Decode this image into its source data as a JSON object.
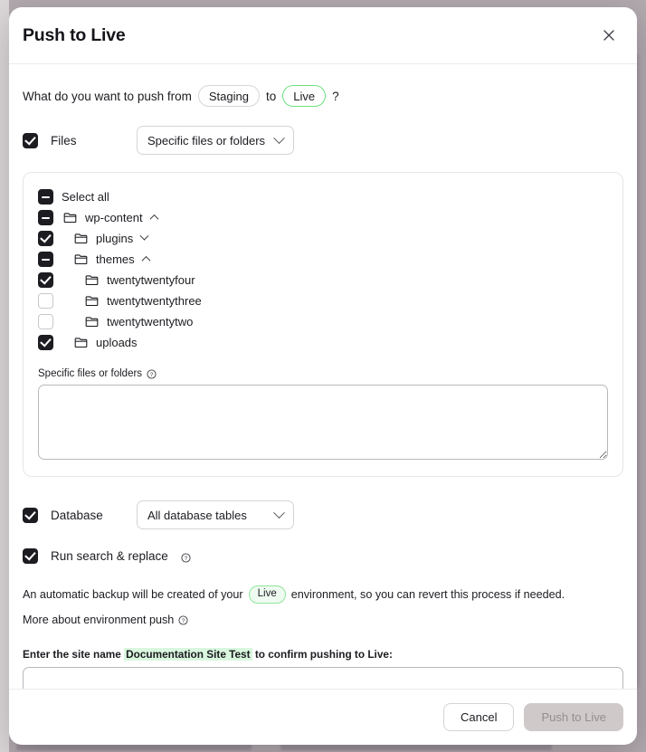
{
  "modal": {
    "title": "Push to Live",
    "close_icon": "close-icon"
  },
  "question": {
    "prefix": "What do you want to push from",
    "source_env": "Staging",
    "connector": "to",
    "target_env": "Live",
    "suffix": "?"
  },
  "files": {
    "label": "Files",
    "checked": true,
    "select_value": "Specific files or folders"
  },
  "tree": {
    "select_all_label": "Select all",
    "select_all_state": "indeterminate",
    "nodes": [
      {
        "label": "wp-content",
        "state": "indeterminate",
        "depth": 0,
        "caret": "up",
        "folder": true
      },
      {
        "label": "plugins",
        "state": "checked",
        "depth": 1,
        "caret": "down",
        "folder": true
      },
      {
        "label": "themes",
        "state": "indeterminate",
        "depth": 1,
        "caret": "up",
        "folder": true
      },
      {
        "label": "twentytwentyfour",
        "state": "checked",
        "depth": 2,
        "caret": "",
        "folder": true
      },
      {
        "label": "twentytwentythree",
        "state": "unchecked",
        "depth": 2,
        "caret": "",
        "folder": true
      },
      {
        "label": "twentytwentytwo",
        "state": "unchecked",
        "depth": 2,
        "caret": "",
        "folder": true
      },
      {
        "label": "uploads",
        "state": "checked",
        "depth": 1,
        "caret": "",
        "folder": true
      }
    ]
  },
  "specific_files": {
    "label": "Specific files or folders",
    "help_icon": "help-circle-icon",
    "value": "",
    "placeholder": ""
  },
  "database": {
    "label": "Database",
    "checked": true,
    "select_value": "All database tables"
  },
  "search_replace": {
    "label": "Run search & replace",
    "checked": true,
    "help_icon": "help-circle-icon"
  },
  "notes": {
    "backup_prefix": "An automatic backup will be created of your",
    "backup_env": "Live",
    "backup_suffix": "environment, so you can revert this process if needed.",
    "more_link": "More about environment push",
    "more_help_icon": "help-circle-icon"
  },
  "confirm": {
    "prefix": "Enter the site name",
    "site_name": "Documentation Site Test",
    "suffix": "to confirm pushing to Live:",
    "value": "",
    "placeholder": ""
  },
  "footer": {
    "cancel_label": "Cancel",
    "submit_label": "Push to Live",
    "submit_disabled": true
  },
  "colors": {
    "accent_green": "#6ee07f",
    "highlight_green": "#d9f7de",
    "checkbox_dark": "#1d1c21",
    "disabled_button": "#cfc9ca"
  }
}
